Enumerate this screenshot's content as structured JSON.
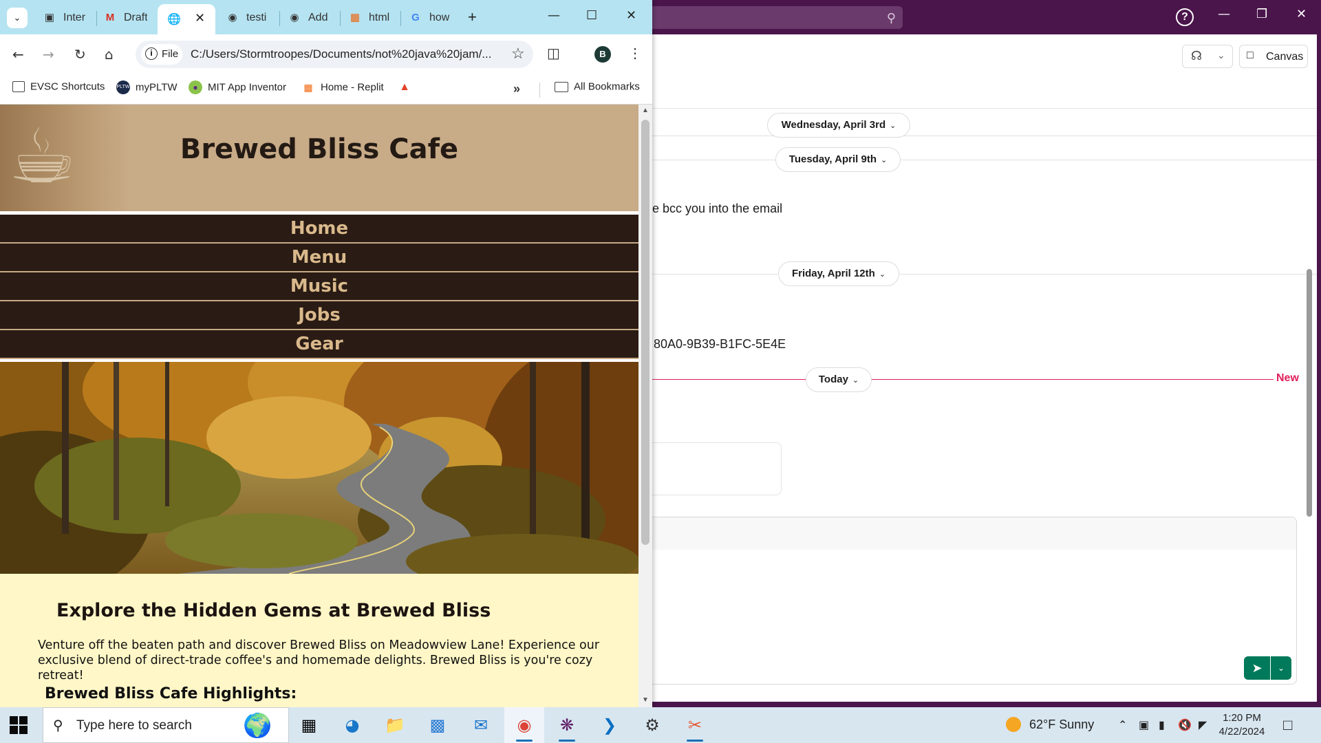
{
  "chrome": {
    "tabs": [
      {
        "label": "Inter",
        "icon": "contact-card-icon"
      },
      {
        "label": "Draft",
        "icon": "gmail-icon"
      },
      {
        "label": "",
        "icon": "globe-icon"
      },
      {
        "label": "testi",
        "icon": "github-icon"
      },
      {
        "label": "Add",
        "icon": "github-icon"
      },
      {
        "label": "html",
        "icon": "replit-icon"
      },
      {
        "label": "how",
        "icon": "google-icon"
      }
    ],
    "address": {
      "chip_label": "File",
      "url": "C:/Users/Stormtroopes/Documents/not%20java%20jam/..."
    },
    "profile_initial": "B",
    "bookmarks": [
      {
        "label": "EVSC Shortcuts",
        "icon": "apps-folder-icon"
      },
      {
        "label": "myPLTW",
        "icon": "pltw-icon"
      },
      {
        "label": "MIT App Inventor",
        "icon": "app-inventor-icon"
      },
      {
        "label": "Home - Replit",
        "icon": "replit-icon"
      },
      {
        "label": "",
        "icon": "gitlab-icon"
      }
    ],
    "all_bookmarks_label": "All Bookmarks"
  },
  "site": {
    "title": "Brewed Bliss Cafe",
    "nav": [
      "Home",
      "Menu",
      "Music",
      "Jobs",
      "Gear"
    ],
    "explore_heading": "Explore the Hidden Gems at Brewed Bliss",
    "explore_text": "Venture off the beaten path and discover Brewed Bliss on Meadowview Lane! Experience our exclusive blend of direct-trade coffee's and homemade delights. Brewed Bliss is you're cozy retreat!",
    "highlights_heading": "Brewed Bliss Cafe Highlights:"
  },
  "slack": {
    "canvas_label": "Canvas",
    "date_pills": [
      "Wednesday, April 3rd",
      "Tuesday, April 9th",
      "Friday, April 12th",
      "Today"
    ],
    "message_1": "e bcc you into the email",
    "message_2": "80A0-9B39-B1FC-5E4E",
    "new_label": "New",
    "colors": {
      "aubergine": "#4a154b",
      "new_line": "#e01e5a",
      "send": "#007a5a"
    }
  },
  "taskbar": {
    "search_placeholder": "Type here to search",
    "weather": "62°F  Sunny",
    "time": "1:20 PM",
    "date": "4/22/2024"
  }
}
